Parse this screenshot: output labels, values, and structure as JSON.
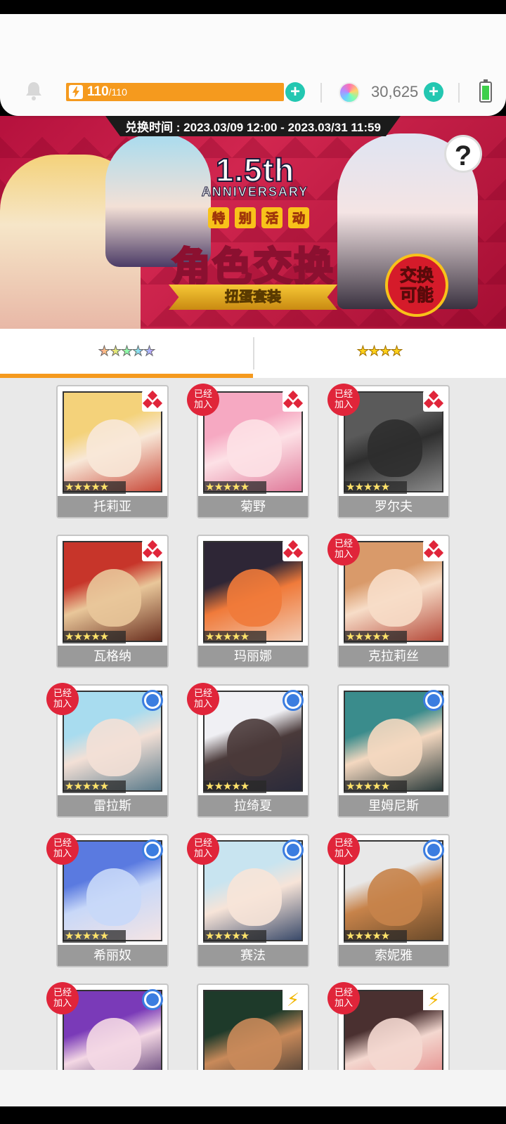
{
  "hud": {
    "energy_current": "110",
    "energy_max": "/110",
    "energy_level": 1.0,
    "gems": "30,625",
    "plus_label": "+"
  },
  "banner": {
    "exchange_time": "兑换时间 : 2023.03/09 12:00 - 2023.03/31 11:59",
    "anniversary": "1.5th",
    "anniversary_sub": "ANNIVERSARY",
    "special_chars": [
      "特",
      "别",
      "活",
      "动"
    ],
    "title": "角色交换",
    "ribbon": "扭蛋套装",
    "badge": "交换可能",
    "help": "?"
  },
  "tabs": [
    {
      "label": "★★★★★",
      "selected": true
    },
    {
      "label": "★★★★",
      "selected": false
    }
  ],
  "joined_label": "已经加入",
  "star_text": "★★★★★",
  "cards": [
    {
      "name": "托莉亚",
      "joined": false,
      "attr": "diamond",
      "c1": "#f4d27a",
      "c2": "#f8e8d8",
      "c3": "#c94a3a"
    },
    {
      "name": "菊野",
      "joined": true,
      "attr": "diamond",
      "c1": "#f6a9c2",
      "c2": "#fde1e6",
      "c3": "#e07a9a"
    },
    {
      "name": "罗尔夫",
      "joined": true,
      "attr": "diamond",
      "c1": "#5a5a5a",
      "c2": "#2e2e2e",
      "c3": "#8a8a8a"
    },
    {
      "name": "瓦格纳",
      "joined": false,
      "attr": "diamond",
      "c1": "#c7352a",
      "c2": "#e9c79a",
      "c3": "#6a2f1f"
    },
    {
      "name": "玛丽娜",
      "joined": false,
      "attr": "diamond",
      "c1": "#2e2636",
      "c2": "#f07a3a",
      "c3": "#f2cbb3"
    },
    {
      "name": "克拉莉丝",
      "joined": true,
      "attr": "diamond",
      "c1": "#d99a6a",
      "c2": "#f7ddc8",
      "c3": "#b54a3a"
    },
    {
      "name": "雷拉斯",
      "joined": true,
      "attr": "circle",
      "c1": "#a8dcef",
      "c2": "#f3e0d6",
      "c3": "#5a7a8a"
    },
    {
      "name": "拉绮夏",
      "joined": true,
      "attr": "circle",
      "c1": "#f0f0f4",
      "c2": "#4a3a3a",
      "c3": "#2a2a3a"
    },
    {
      "name": "里姆尼斯",
      "joined": false,
      "attr": "circle",
      "c1": "#3a8c8c",
      "c2": "#f4d8c0",
      "c3": "#2a3a3a"
    },
    {
      "name": "希丽奴",
      "joined": true,
      "attr": "circle",
      "c1": "#5a7ae0",
      "c2": "#c8d8f8",
      "c3": "#f4e4e4"
    },
    {
      "name": "赛法",
      "joined": true,
      "attr": "circle",
      "c1": "#c8e4f0",
      "c2": "#f7e4d8",
      "c3": "#3a4a6a"
    },
    {
      "name": "索妮雅",
      "joined": true,
      "attr": "circle",
      "c1": "#e8e8e8",
      "c2": "#c7834a",
      "c3": "#6a4a2a"
    },
    {
      "name": "",
      "joined": true,
      "attr": "circle",
      "c1": "#7a3ab8",
      "c2": "#f4d8e4",
      "c3": "#3a1a5a"
    },
    {
      "name": "",
      "joined": false,
      "attr": "bolt",
      "c1": "#1e3a2a",
      "c2": "#c98a5a",
      "c3": "#2a2a2a"
    },
    {
      "name": "",
      "joined": true,
      "attr": "bolt",
      "c1": "#4a3030",
      "c2": "#f4d8d0",
      "c3": "#e07a7a"
    }
  ]
}
